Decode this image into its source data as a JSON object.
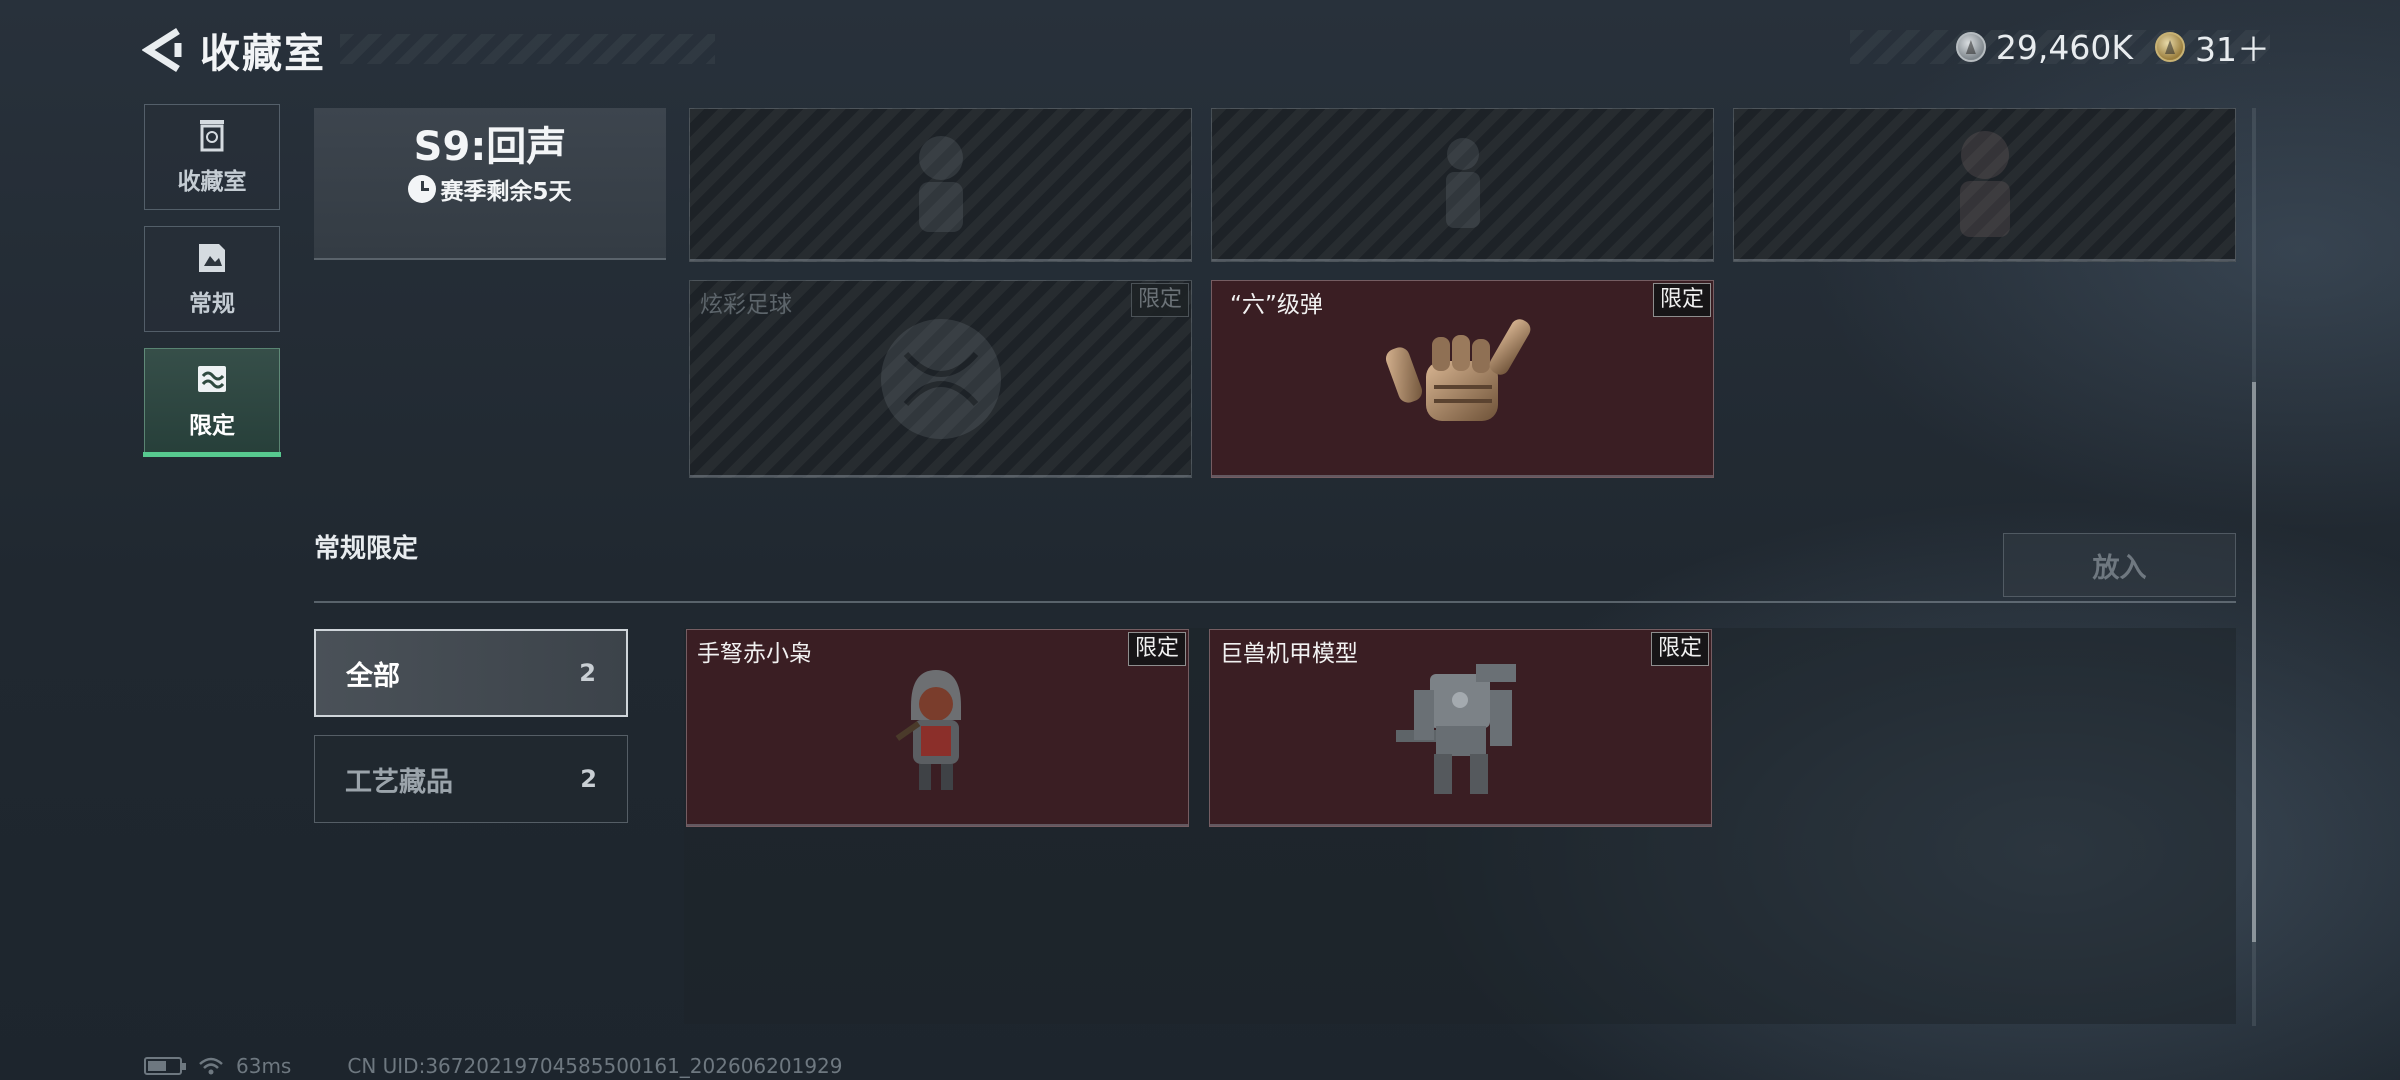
{
  "header": {
    "title": "收藏室"
  },
  "currency": [
    {
      "icon": "silver-coin-icon",
      "value": "29,460K"
    },
    {
      "icon": "gold-coin-icon",
      "value": "31＋"
    }
  ],
  "nav": [
    {
      "label": "收藏室",
      "icon": "collection-icon",
      "active": false
    },
    {
      "label": "常规",
      "icon": "regular-icon",
      "active": false
    },
    {
      "label": "限定",
      "icon": "limited-icon",
      "active": true
    }
  ],
  "season": {
    "title": "S9:回声",
    "remaining": "赛季剩余5天"
  },
  "season_items": [
    {
      "name": "",
      "locked": true,
      "tag": "",
      "icon": "figure-icon"
    },
    {
      "name": "",
      "locked": true,
      "tag": "",
      "icon": "figure-icon"
    },
    {
      "name": "",
      "locked": true,
      "tag": "",
      "icon": "figure-icon"
    },
    {
      "name": "炫彩足球",
      "locked": true,
      "tag": "限定",
      "icon": "football-icon"
    },
    {
      "name": "“六”级弹",
      "locked": false,
      "tag": "限定",
      "icon": "shaka-hand-icon"
    }
  ],
  "regular_limited": {
    "title": "常规限定",
    "put_button": "放入",
    "filters": [
      {
        "label": "全部",
        "count": "2",
        "active": true
      },
      {
        "label": "工艺藏品",
        "count": "2",
        "active": false
      }
    ],
    "items": [
      {
        "name": "手弩赤小枭",
        "tag": "限定",
        "icon": "hooded-figure-icon"
      },
      {
        "name": "巨兽机甲模型",
        "tag": "限定",
        "icon": "mech-model-icon"
      }
    ]
  },
  "status": {
    "ping": "63ms",
    "uid": "CN UID:3672021970458550016​1_202606201929"
  },
  "colors": {
    "accent_green": "#57c98f",
    "owned_card": "#3a1e23",
    "locked_card": "#1d2227"
  }
}
